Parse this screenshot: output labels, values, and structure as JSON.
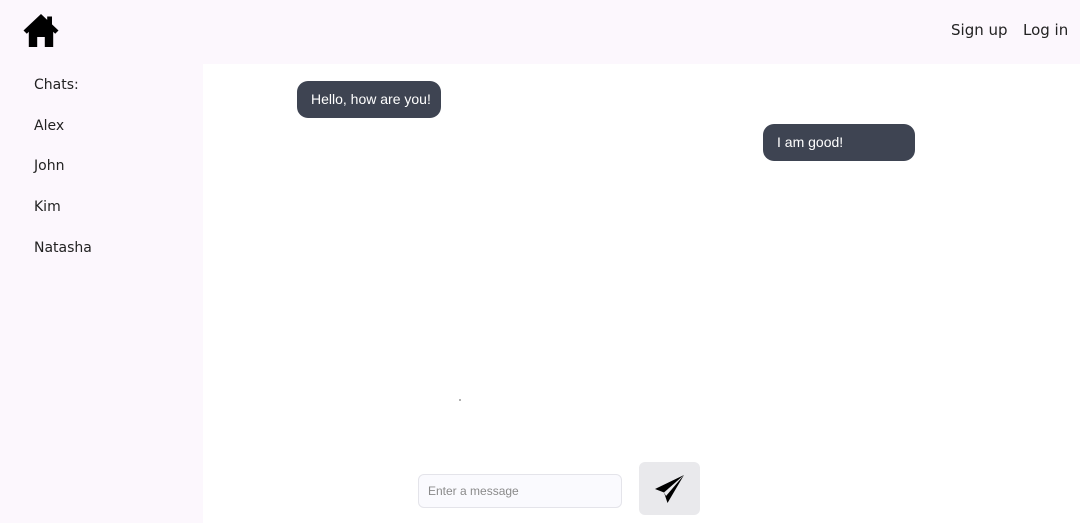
{
  "header": {
    "home_icon": "home-icon",
    "nav": {
      "signup_label": "Sign up",
      "login_label": "Log in"
    }
  },
  "sidebar": {
    "heading": "Chats:",
    "chats": [
      {
        "name": "Alex"
      },
      {
        "name": "John"
      },
      {
        "name": "Kim"
      },
      {
        "name": "Natasha"
      }
    ]
  },
  "conversation": {
    "messages": [
      {
        "text": "Hello, how are you!"
      },
      {
        "text": "I am good!"
      }
    ]
  },
  "composer": {
    "placeholder": "Enter a message",
    "value": "",
    "send_icon": "paper-plane-icon"
  },
  "colors": {
    "background": "#fcf7fd",
    "panel": "#ffffff",
    "bubble": "#3e4452",
    "bubble_text": "#ffffff",
    "send_button": "#e9e9ec"
  }
}
